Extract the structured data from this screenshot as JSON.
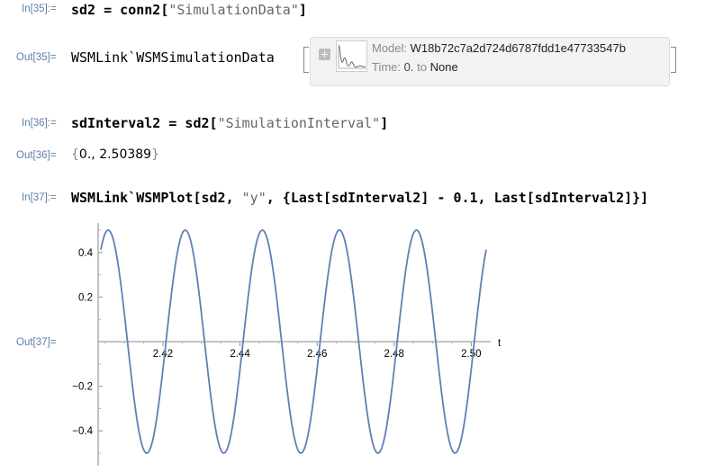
{
  "cells": [
    {
      "in_label": "In[35]:=",
      "code": {
        "lhs": "sd2 = conn2[",
        "str": "\"SimulationData\"",
        "rhs": "]"
      }
    },
    {
      "out_label": "Out[35]=",
      "head": "WSMLink`WSMSimulationData",
      "summary": {
        "model_key": "Model:",
        "model_value": "W18b72c7a2d724d6787fdd1e47733547b",
        "time_key": "Time:",
        "time_start": "0.",
        "time_to": "to",
        "time_end": "None"
      },
      "icons": {
        "expand": "expand-plus-icon",
        "thumbnail": "damped-oscillation-thumbnail-icon"
      }
    },
    {
      "in_label": "In[36]:=",
      "code": {
        "lhs": "sdInterval2 = sd2[",
        "str": "\"SimulationInterval\"",
        "rhs": "]"
      }
    },
    {
      "out_label": "Out[36]=",
      "open": "{",
      "v1": "0.",
      "sep": ",",
      "v2": "2.50389",
      "close": "}"
    },
    {
      "in_label": "In[37]:=",
      "code": {
        "lhs": "WSMLink`WSMPlot[sd2, ",
        "str": "\"y\"",
        "rhs": ", {Last[sdInterval2] - 0.1, Last[sdInterval2]}]"
      }
    },
    {
      "out_label": "Out[37]="
    }
  ],
  "chart_data": {
    "type": "line",
    "xlabel": "t",
    "ylabel": "",
    "xlim": [
      2.40389,
      2.50389
    ],
    "ylim": [
      -0.5,
      0.5
    ],
    "x_ticks": [
      "2.42",
      "2.44",
      "2.46",
      "2.48",
      "2.50"
    ],
    "x_tick_values": [
      2.42,
      2.44,
      2.46,
      2.48,
      2.5
    ],
    "y_ticks": [
      "0.4",
      "0.2",
      "−0.2",
      "−0.4"
    ],
    "y_tick_values": [
      0.4,
      0.2,
      -0.2,
      -0.4
    ],
    "series": [
      {
        "amplitude": 0.5,
        "period": 0.02,
        "phase_peak_x": 2.4058,
        "color": "#5e81b5"
      }
    ],
    "grid": false
  }
}
